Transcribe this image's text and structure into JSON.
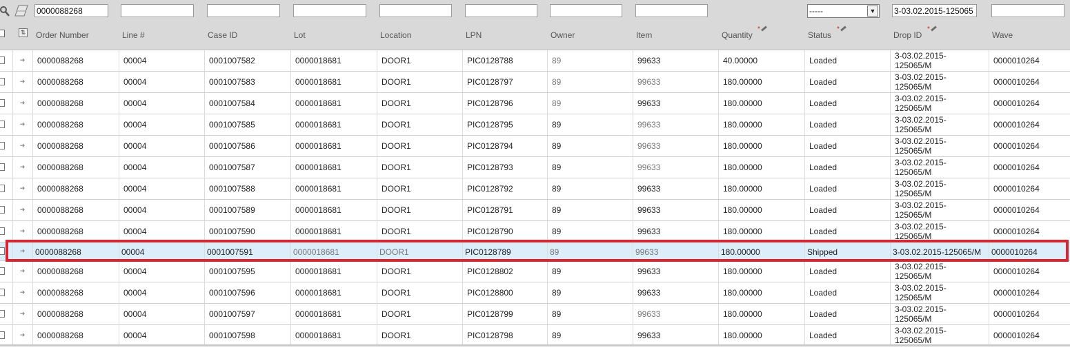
{
  "filters": {
    "order_number": "0000088268",
    "line": "",
    "case_id": "",
    "lot": "",
    "location": "",
    "lpn": "",
    "owner": "",
    "item": "",
    "status_selected": "-----",
    "drop_id": "3-03.02.2015-125065",
    "wave": ""
  },
  "icons": {
    "search": "search-icon",
    "clear": "eraser-icon",
    "select_all": "checkbox-icon",
    "columns": "column-settings-icon",
    "row_action": "row-arrow-icon",
    "required": "required-edit-icon"
  },
  "columns": {
    "order_number": "Order Number",
    "line": "Line #",
    "case_id": "Case ID",
    "lot": "Lot",
    "location": "Location",
    "lpn": "LPN",
    "owner": "Owner",
    "item": "Item",
    "quantity": "Quantity",
    "status": "Status",
    "drop_id": "Drop ID",
    "wave": "Wave"
  },
  "rows": [
    {
      "order": "0000088268",
      "line": "00004",
      "case": "0001007582",
      "lot": "0000018681",
      "loc": "DOOR1",
      "lpn": "PIC0128788",
      "owner": "89",
      "item": "99633",
      "qty": "40.00000",
      "status": "Loaded",
      "drop1": "3-03.02.2015-",
      "drop2": "125065/M",
      "wave": "0000010264"
    },
    {
      "order": "0000088268",
      "line": "00004",
      "case": "0001007583",
      "lot": "0000018681",
      "loc": "DOOR1",
      "lpn": "PIC0128797",
      "owner": "89",
      "item": "99633",
      "qty": "180.00000",
      "status": "Loaded",
      "drop1": "3-03.02.2015-",
      "drop2": "125065/M",
      "wave": "0000010264"
    },
    {
      "order": "0000088268",
      "line": "00004",
      "case": "0001007584",
      "lot": "0000018681",
      "loc": "DOOR1",
      "lpn": "PIC0128796",
      "owner": "89",
      "item": "99633",
      "qty": "180.00000",
      "status": "Loaded",
      "drop1": "3-03.02.2015-",
      "drop2": "125065/M",
      "wave": "0000010264"
    },
    {
      "order": "0000088268",
      "line": "00004",
      "case": "0001007585",
      "lot": "0000018681",
      "loc": "DOOR1",
      "lpn": "PIC0128795",
      "owner": "89",
      "item": "99633",
      "qty": "180.00000",
      "status": "Loaded",
      "drop1": "3-03.02.2015-",
      "drop2": "125065/M",
      "wave": "0000010264"
    },
    {
      "order": "0000088268",
      "line": "00004",
      "case": "0001007586",
      "lot": "0000018681",
      "loc": "DOOR1",
      "lpn": "PIC0128794",
      "owner": "89",
      "item": "99633",
      "qty": "180.00000",
      "status": "Loaded",
      "drop1": "3-03.02.2015-",
      "drop2": "125065/M",
      "wave": "0000010264"
    },
    {
      "order": "0000088268",
      "line": "00004",
      "case": "0001007587",
      "lot": "0000018681",
      "loc": "DOOR1",
      "lpn": "PIC0128793",
      "owner": "89",
      "item": "99633",
      "qty": "180.00000",
      "status": "Loaded",
      "drop1": "3-03.02.2015-",
      "drop2": "125065/M",
      "wave": "0000010264"
    },
    {
      "order": "0000088268",
      "line": "00004",
      "case": "0001007588",
      "lot": "0000018681",
      "loc": "DOOR1",
      "lpn": "PIC0128792",
      "owner": "89",
      "item": "99633",
      "qty": "180.00000",
      "status": "Loaded",
      "drop1": "3-03.02.2015-",
      "drop2": "125065/M",
      "wave": "0000010264"
    },
    {
      "order": "0000088268",
      "line": "00004",
      "case": "0001007589",
      "lot": "0000018681",
      "loc": "DOOR1",
      "lpn": "PIC0128791",
      "owner": "89",
      "item": "99633",
      "qty": "180.00000",
      "status": "Loaded",
      "drop1": "3-03.02.2015-",
      "drop2": "125065/M",
      "wave": "0000010264"
    },
    {
      "order": "0000088268",
      "line": "00004",
      "case": "0001007590",
      "lot": "0000018681",
      "loc": "DOOR1",
      "lpn": "PIC0128790",
      "owner": "89",
      "item": "99633",
      "qty": "180.00000",
      "status": "Loaded",
      "drop1": "3-03.02.2015-",
      "drop2": "125065/M",
      "wave": "0000010264"
    },
    {
      "order": "0000088268",
      "line": "00004",
      "case": "0001007591",
      "lot": "0000018681",
      "loc": "DOOR1",
      "lpn": "PIC0128789",
      "owner": "89",
      "item": "99633",
      "qty": "180.00000",
      "status": "Shipped",
      "drop1": "3-03.02.2015-125065/M",
      "drop2": "",
      "wave": "0000010264"
    },
    {
      "order": "0000088268",
      "line": "00004",
      "case": "0001007595",
      "lot": "0000018681",
      "loc": "DOOR1",
      "lpn": "PIC0128802",
      "owner": "89",
      "item": "99633",
      "qty": "180.00000",
      "status": "Loaded",
      "drop1": "3-03.02.2015-",
      "drop2": "125065/M",
      "wave": "0000010264"
    },
    {
      "order": "0000088268",
      "line": "00004",
      "case": "0001007596",
      "lot": "0000018681",
      "loc": "DOOR1",
      "lpn": "PIC0128800",
      "owner": "89",
      "item": "99633",
      "qty": "180.00000",
      "status": "Loaded",
      "drop1": "3-03.02.2015-",
      "drop2": "125065/M",
      "wave": "0000010264"
    },
    {
      "order": "0000088268",
      "line": "00004",
      "case": "0001007597",
      "lot": "0000018681",
      "loc": "DOOR1",
      "lpn": "PIC0128799",
      "owner": "89",
      "item": "99633",
      "qty": "180.00000",
      "status": "Loaded",
      "drop1": "3-03.02.2015-",
      "drop2": "125065/M",
      "wave": "0000010264"
    },
    {
      "order": "0000088268",
      "line": "00004",
      "case": "0001007598",
      "lot": "0000018681",
      "loc": "DOOR1",
      "lpn": "PIC0128798",
      "owner": "89",
      "item": "99633",
      "qty": "180.00000",
      "status": "Loaded",
      "drop1": "3-03.02.2015-",
      "drop2": "125065/M",
      "wave": "0000010264"
    }
  ],
  "selected_row_index": 9,
  "colors": {
    "header_bg": "#d9d9d9",
    "selected_bg": "#dbeefa",
    "selection_frame": "#d9252f",
    "required_marker": "#c62828"
  }
}
